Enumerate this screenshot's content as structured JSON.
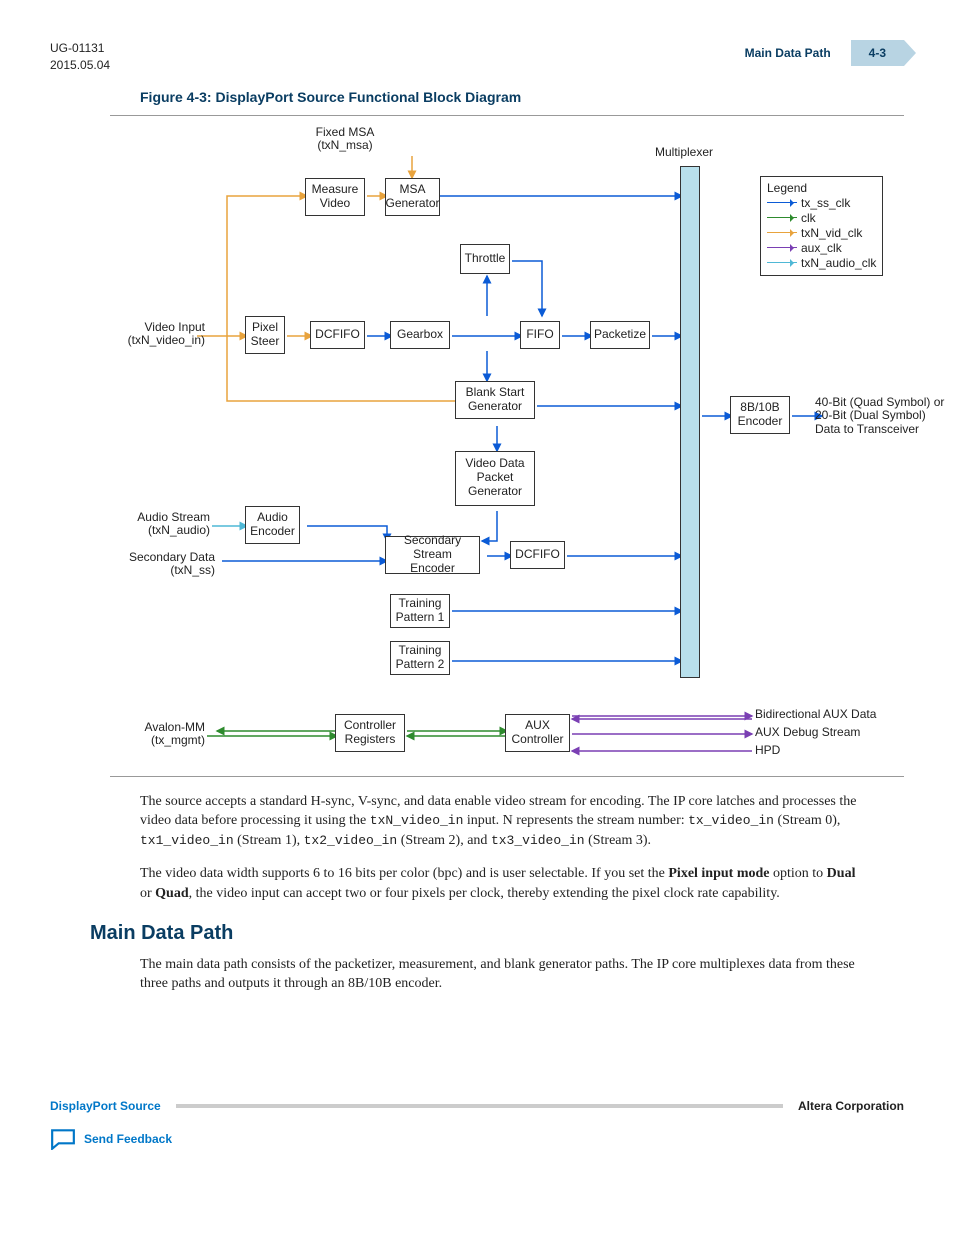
{
  "header": {
    "doc_id": "UG-01131",
    "date": "2015.05.04",
    "title": "Main Data Path",
    "pagenum": "4-3"
  },
  "figure": {
    "title": "Figure 4-3: DisplayPort Source Functional Block Diagram",
    "blocks": {
      "measure_video": "Measure\nVideo",
      "msa_gen": "MSA\nGenerator",
      "throttle": "Throttle",
      "pixel_steer": "Pixel\nSteer",
      "dcfifo1": "DCFIFO",
      "gearbox": "Gearbox",
      "fifo": "FIFO",
      "packetize": "Packetize",
      "blank_start": "Blank Start\nGenerator",
      "vdp_gen": "Video Data\nPacket\nGenerator",
      "audio_enc": "Audio\nEncoder",
      "sec_enc": "Secondary\nStream Encoder",
      "dcfifo2": "DCFIFO",
      "tp1": "Training\nPattern 1",
      "tp2": "Training\nPattern 2",
      "ctrl_reg": "Controller\nRegisters",
      "aux_ctrl": "AUX\nController",
      "encoder": "8B/10B\nEncoder"
    },
    "labels": {
      "fixed_msa": "Fixed MSA\n(txN_msa)",
      "multiplexer": "Multiplexer",
      "video_input": "Video Input\n(txN_video_in)",
      "audio_stream": "Audio Stream\n(txN_audio)",
      "secondary_data": "Secondary Data\n(txN_ss)",
      "avalon": "Avalon-MM\n(tx_mgmt)",
      "out40": "40-Bit (Quad Symbol) or\n20-Bit (Dual Symbol)\nData to Transceiver",
      "aux_bi": "Bidirectional AUX Data",
      "aux_dbg": "AUX Debug Stream",
      "hpd": "HPD"
    },
    "legend": {
      "title": "Legend",
      "items": [
        {
          "color": "#0b5bd6",
          "label": "tx_ss_clk"
        },
        {
          "color": "#2e8b2e",
          "label": "clk"
        },
        {
          "color": "#e8a33d",
          "label": "txN_vid_clk"
        },
        {
          "color": "#7a3fb3",
          "label": "aux_clk"
        },
        {
          "color": "#4fb8d6",
          "label": "txN_audio_clk"
        }
      ]
    }
  },
  "body": {
    "p1a": "The source accepts a standard H-sync, V-sync, and data enable video stream for encoding. The IP core latches and processes the video data before processing it using the ",
    "p1_code": "txN_video_in",
    "p1b": " input. N represents the stream number: ",
    "s0": "tx_video_in",
    "s0t": " (Stream 0), ",
    "s1": "tx1_video_in",
    "s1t": " (Stream 1), ",
    "s2": "tx2_video_in",
    "s2t": " (Stream 2), and ",
    "s3": "tx3_video_in",
    "s3t": " (Stream 3).",
    "p2a": "The video data width supports 6 to 16 bits per color (bpc) and is user selectable. If you set the ",
    "p2b": "Pixel input mode",
    "p2c": " option to ",
    "p2d": "Dual",
    "p2e": " or ",
    "p2f": "Quad",
    "p2g": ", the video input can accept two or four pixels per clock, thereby extending the pixel clock rate capability.",
    "h2": "Main Data Path",
    "p3": "The main data path consists of the packetizer, measurement, and blank generator paths. The IP core multiplexes data from these three paths and outputs it through an 8B/10B encoder."
  },
  "footer": {
    "left": "DisplayPort Source",
    "right": "Altera Corporation",
    "feedback": "Send Feedback"
  }
}
